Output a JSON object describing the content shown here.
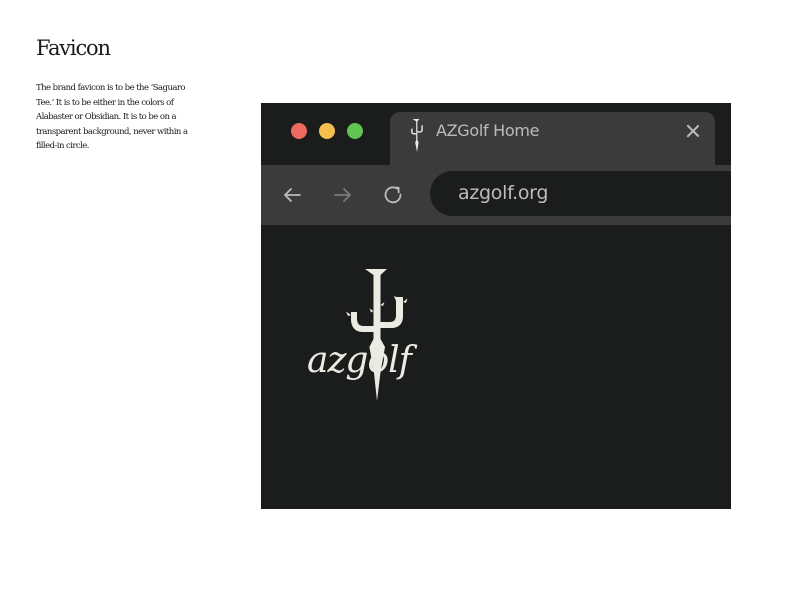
{
  "heading": "Favicon",
  "description": "The brand favicon is to be the ‘Saguaro Tee.’ It is to be either in the colors of Alabaster or Obsidian. It is to be on a transparent background, never within a filled-in circle.",
  "browser": {
    "tab": {
      "icon": "saguaro-tee-icon",
      "title": "AZGolf Home"
    },
    "url": "azgolf.org",
    "logo": {
      "wordmark": "azgolf"
    }
  },
  "colors": {
    "alabaster": "#ecebe3",
    "obsidian": "#1b1c1c",
    "chrome": "#3b3b3b"
  }
}
